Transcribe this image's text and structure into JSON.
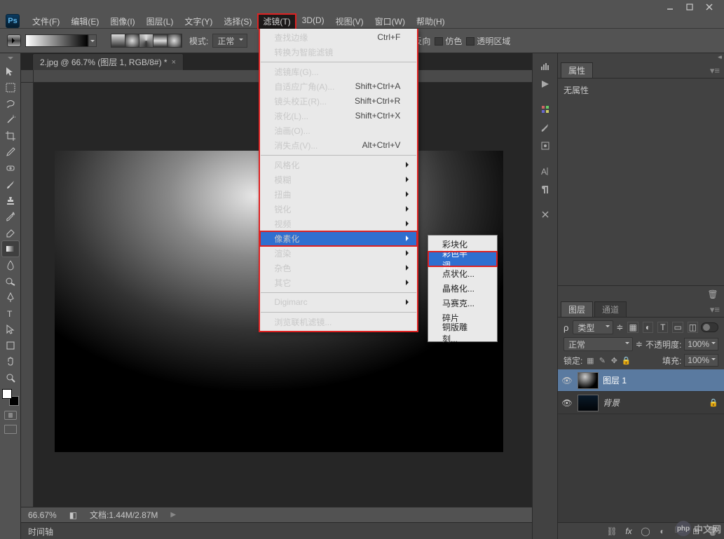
{
  "app": {
    "logo": "Ps"
  },
  "menubar": [
    "文件(F)",
    "编辑(E)",
    "图像(I)",
    "图层(L)",
    "文字(Y)",
    "选择(S)",
    "滤镜(T)",
    "3D(D)",
    "视图(V)",
    "窗口(W)",
    "帮助(H)"
  ],
  "menubar_open_index": 6,
  "options": {
    "mode_label": "模式:",
    "mode_value": "正常",
    "reverse": "反向",
    "dither": "仿色",
    "transparency": "透明区域"
  },
  "doc_tab": {
    "title": "2.jpg @ 66.7% (图层 1, RGB/8#) *",
    "close": "×"
  },
  "status": {
    "zoom": "66.67%",
    "doc": "文档:1.44M/2.87M"
  },
  "timeline_label": "时间轴",
  "panels": {
    "properties": {
      "tab": "属性",
      "body": "无属性"
    },
    "layers": {
      "tabs": [
        "图层",
        "通道"
      ],
      "kind_label": "类型",
      "blend": "正常",
      "opacity_label": "不透明度:",
      "opacity_value": "100%",
      "lock_label": "锁定:",
      "fill_label": "填充:",
      "fill_value": "100%",
      "list": [
        {
          "name": "图层 1",
          "selected": true
        },
        {
          "name": "背景",
          "locked": true
        }
      ]
    }
  },
  "filter_menu": [
    {
      "label": "查找边缘",
      "shortcut": "Ctrl+F"
    },
    {
      "label": "转换为智能滤镜"
    },
    {
      "sep": true
    },
    {
      "label": "滤镜库(G)..."
    },
    {
      "label": "自适应广角(A)...",
      "shortcut": "Shift+Ctrl+A"
    },
    {
      "label": "镜头校正(R)...",
      "shortcut": "Shift+Ctrl+R"
    },
    {
      "label": "液化(L)...",
      "shortcut": "Shift+Ctrl+X"
    },
    {
      "label": "油画(O)..."
    },
    {
      "label": "消失点(V)...",
      "shortcut": "Alt+Ctrl+V"
    },
    {
      "sep": true
    },
    {
      "label": "风格化",
      "sub": true
    },
    {
      "label": "模糊",
      "sub": true
    },
    {
      "label": "扭曲",
      "sub": true
    },
    {
      "label": "锐化",
      "sub": true
    },
    {
      "label": "视频",
      "sub": true
    },
    {
      "label": "像素化",
      "sub": true,
      "hover": true,
      "highlight": true
    },
    {
      "label": "渲染",
      "sub": true
    },
    {
      "label": "杂色",
      "sub": true
    },
    {
      "label": "其它",
      "sub": true
    },
    {
      "sep": true
    },
    {
      "label": "Digimarc",
      "sub": true
    },
    {
      "sep": true
    },
    {
      "label": "浏览联机滤镜..."
    }
  ],
  "pixelate_submenu": [
    {
      "label": "彩块化"
    },
    {
      "label": "彩色半调...",
      "hover": true,
      "highlight": true
    },
    {
      "label": "点状化..."
    },
    {
      "label": "晶格化..."
    },
    {
      "label": "马赛克..."
    },
    {
      "label": "碎片"
    },
    {
      "label": "铜版雕刻..."
    }
  ],
  "watermark": "中文网"
}
